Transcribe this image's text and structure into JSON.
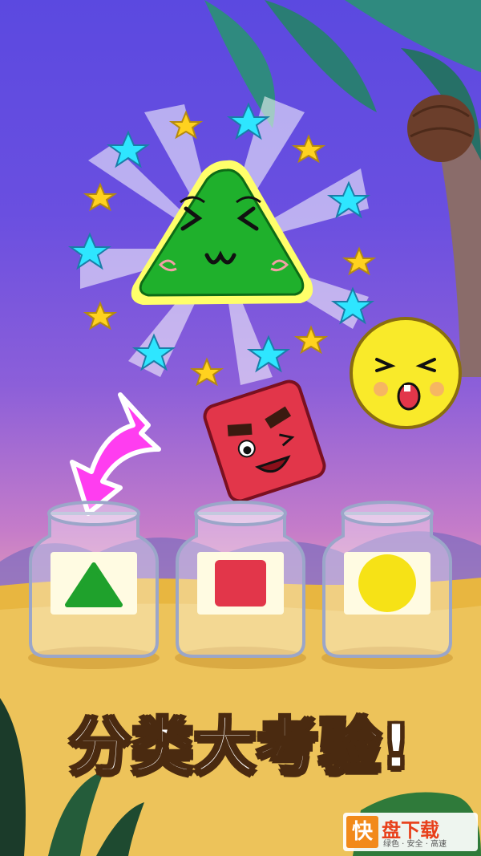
{
  "game": {
    "title": "分类大考验!",
    "jars": [
      {
        "shape": "triangle",
        "color": "#1fa12c"
      },
      {
        "shape": "square",
        "color": "#e2364a"
      },
      {
        "shape": "circle",
        "color": "#f6e216"
      }
    ],
    "characters": [
      "triangle-character",
      "square-character",
      "circle-character"
    ],
    "arrow_color": "#ff3df0"
  },
  "watermark": {
    "logo_char": "快",
    "name": "盘下载",
    "tagline": "绿色 · 安全 · 高速"
  }
}
